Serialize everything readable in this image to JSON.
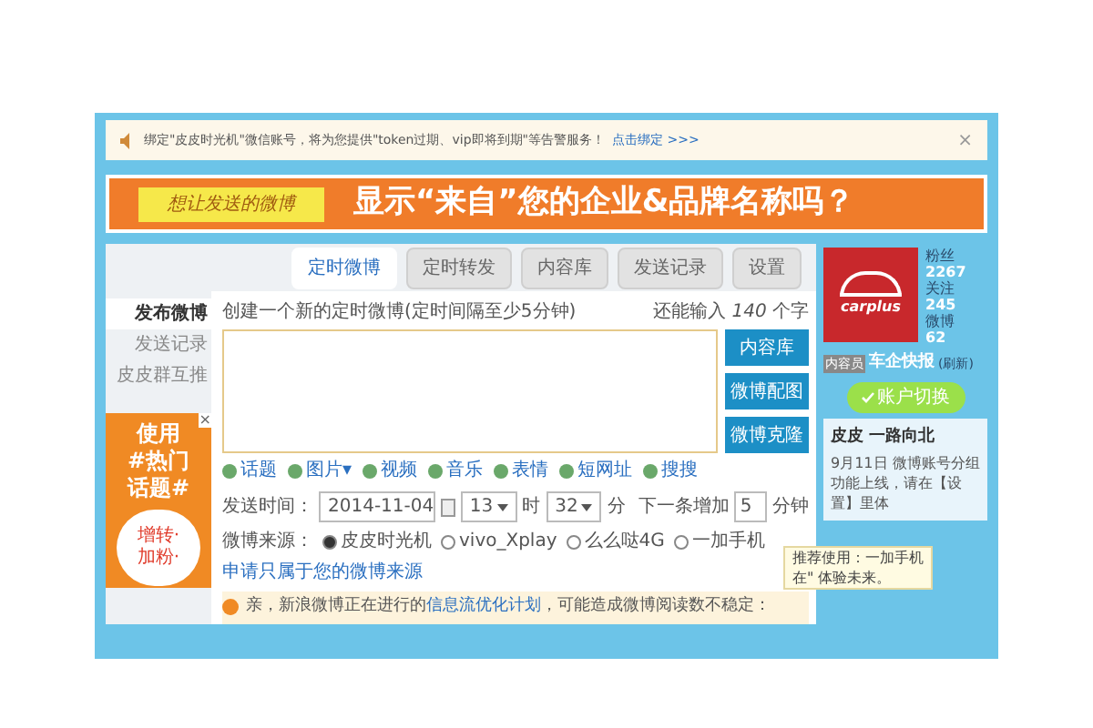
{
  "notice": {
    "text": "绑定\"皮皮时光机\"微信账号，将为您提供\"token过期、vip即将到期\"等告警服务！",
    "link": "点击绑定 >>>",
    "close": "×"
  },
  "banner": {
    "tag": "想让发送的微博",
    "headline": "显示“来自”您的企业&品牌名称吗？"
  },
  "tabs": [
    {
      "label": "定时微博",
      "selected": true
    },
    {
      "label": "定时转发",
      "selected": false
    },
    {
      "label": "内容库",
      "selected": false
    },
    {
      "label": "发送记录",
      "selected": false
    },
    {
      "label": "设置",
      "selected": false
    }
  ],
  "sidebar": {
    "items": [
      {
        "label": "发布微博",
        "selected": true
      },
      {
        "label": "发送记录",
        "selected": false
      },
      {
        "label": "皮皮群互推",
        "selected": false
      }
    ],
    "ad": {
      "lines": [
        "使用",
        "#热门",
        "话题#"
      ],
      "bubble": [
        "增转·",
        "加粉·"
      ],
      "close": "×"
    }
  },
  "composer": {
    "hint": "创建一个新的定时微博(定时间隔至少5分钟)",
    "remaining_prefix": "还能输入",
    "remaining": "140",
    "remaining_suffix": "个字",
    "side_buttons": [
      "内容库",
      "微博配图",
      "微博克隆"
    ]
  },
  "toolbar": [
    {
      "label": "话题"
    },
    {
      "label": "图片▾"
    },
    {
      "label": "视频"
    },
    {
      "label": "音乐"
    },
    {
      "label": "表情"
    },
    {
      "label": "短网址"
    },
    {
      "label": "搜搜"
    }
  ],
  "schedule": {
    "label": "发送时间：",
    "date": "2014-11-04",
    "hour": "13",
    "hour_unit": "时",
    "minute": "32",
    "minute_unit": "分",
    "increment_label": "下一条增加",
    "increment": "5",
    "increment_unit": "分钟"
  },
  "source": {
    "label": "微博来源：",
    "options": [
      {
        "label": "皮皮时光机",
        "selected": true
      },
      {
        "label": "vivo_Xplay",
        "selected": false
      },
      {
        "label": "么么哒4G",
        "selected": false
      },
      {
        "label": "一加手机",
        "selected": false
      }
    ],
    "link": "申请只属于您的微博来源",
    "tooltip": [
      "推荐使用：一加手机",
      "在\" 体验未来。"
    ]
  },
  "warning": {
    "before": "亲，新浪微博正在进行的",
    "link": "信息流优化计划",
    "after": "，可能造成微博阅读数不稳定："
  },
  "profile": {
    "logo": "carplus",
    "stats": [
      {
        "label": "粉丝",
        "value": "2267"
      },
      {
        "label": "关注",
        "value": "245"
      },
      {
        "label": "微博",
        "value": "62"
      }
    ],
    "badge": "内容员",
    "name": "车企快报",
    "refresh": "(刷新)",
    "switch": "账户切换",
    "news_title": "皮皮 一路向北",
    "news_body": "9月11日 微博账号分组功能上线，请在【设置】里体"
  }
}
